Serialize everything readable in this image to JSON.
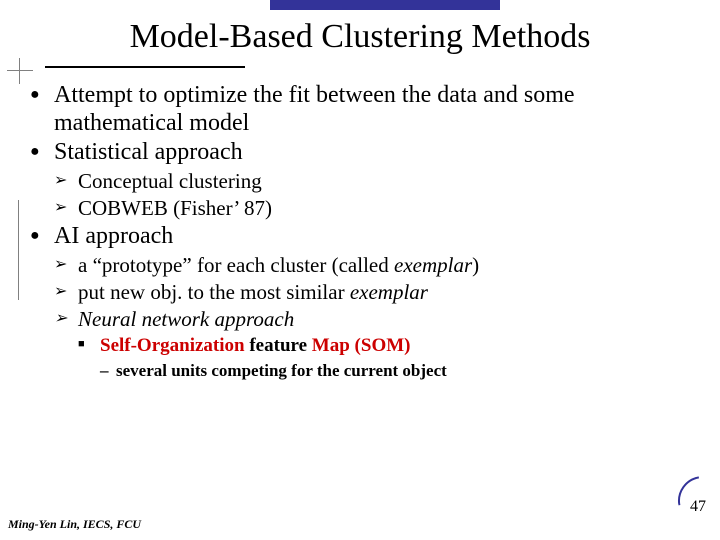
{
  "title": "Model-Based Clustering Methods",
  "bullets": {
    "b1": "Attempt to optimize the fit between the data and some mathematical model",
    "b2": "Statistical approach",
    "b2a": "Conceptual clustering",
    "b2b": "COBWEB (Fisher’ 87)",
    "b3": "AI approach",
    "b3a_pre": "a “prototype” for each cluster (called ",
    "b3a_em": "exemplar",
    "b3a_post": ")",
    "b3b_pre": "put new obj. to the most similar ",
    "b3b_em": "exemplar",
    "b3c": "Neural network approach",
    "b3c1_a": "Self-Organization",
    "b3c1_b": " feature ",
    "b3c1_c": "Map (SOM)",
    "b3c1x": "several units competing for the current object"
  },
  "footer": "Ming-Yen Lin, IECS, FCU",
  "page": "47"
}
